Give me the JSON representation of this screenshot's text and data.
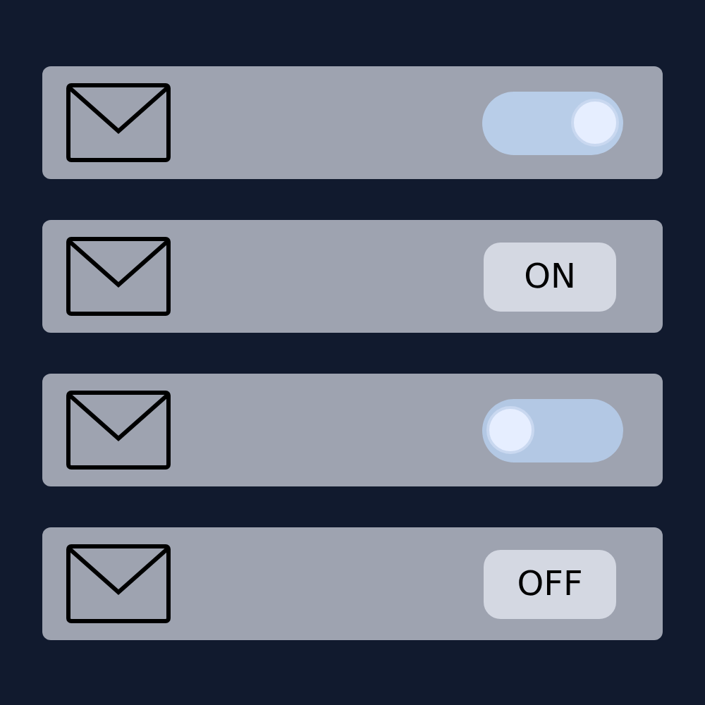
{
  "rows": [
    {
      "kind": "switch",
      "on": true
    },
    {
      "kind": "label",
      "text": "ON"
    },
    {
      "kind": "switch",
      "on": false
    },
    {
      "kind": "label",
      "text": "OFF"
    }
  ]
}
